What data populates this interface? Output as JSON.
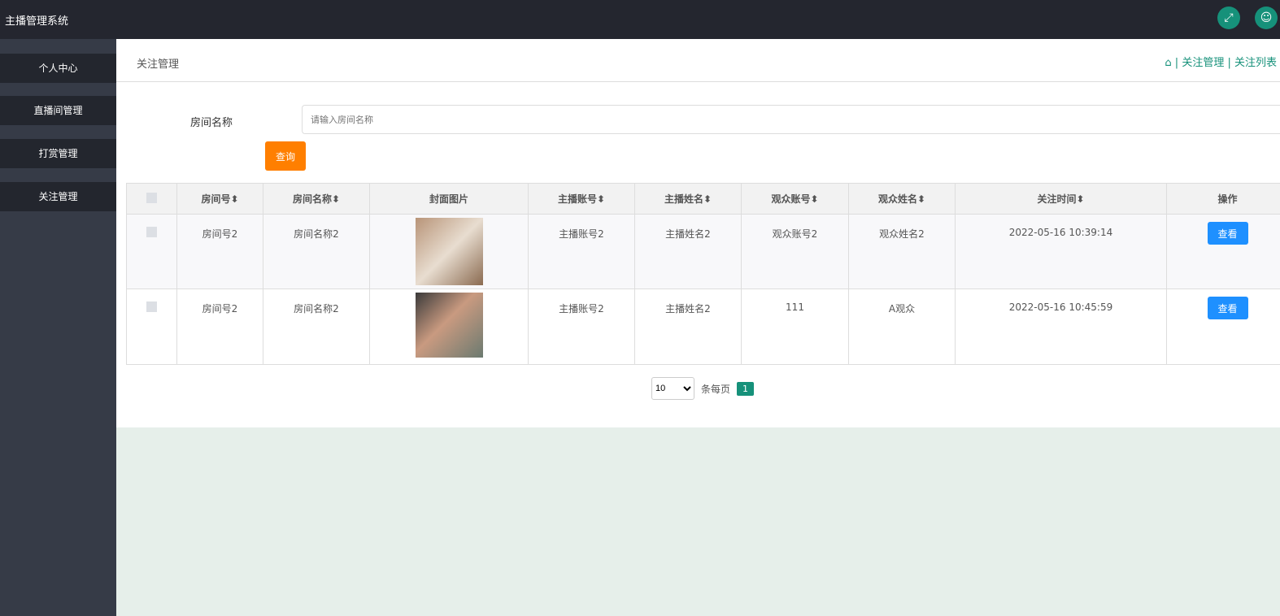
{
  "header": {
    "title": "主播管理系统",
    "icons": [
      "fullscreen-icon",
      "user-icon"
    ]
  },
  "sidebar": {
    "items": [
      {
        "label": "个人中心"
      },
      {
        "label": "直播间管理"
      },
      {
        "label": "打赏管理"
      },
      {
        "label": "关注管理"
      }
    ]
  },
  "page": {
    "title": "关注管理",
    "breadcrumb": [
      "关注管理",
      "关注列表"
    ]
  },
  "search": {
    "label": "房间名称",
    "placeholder": "请输入房间名称",
    "button": "查询"
  },
  "table": {
    "headers": [
      "房间号⬍",
      "房间名称⬍",
      "封面图片",
      "主播账号⬍",
      "主播姓名⬍",
      "观众账号⬍",
      "观众姓名⬍",
      "关注时间⬍",
      "操作"
    ],
    "rows": [
      {
        "room_no": "房间号2",
        "room_name": "房间名称2",
        "anchor_account": "主播账号2",
        "anchor_name": "主播姓名2",
        "viewer_account": "观众账号2",
        "viewer_name": "观众姓名2",
        "time": "2022-05-16 10:39:14",
        "action": "查看"
      },
      {
        "room_no": "房间号2",
        "room_name": "房间名称2",
        "anchor_account": "主播账号2",
        "anchor_name": "主播姓名2",
        "viewer_account": "111",
        "viewer_name": "A观众",
        "time": "2022-05-16 10:45:59",
        "action": "查看"
      }
    ]
  },
  "pagination": {
    "page_size": "10",
    "per_page_label": "条每页",
    "current_page": "1"
  }
}
